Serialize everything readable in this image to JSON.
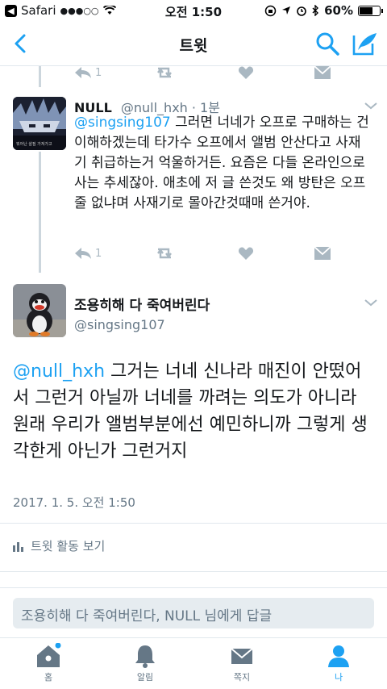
{
  "status_bar": {
    "back_app": "Safari",
    "signal": "●●●○○",
    "time": "오전 1:50",
    "battery": "60%"
  },
  "nav": {
    "title": "트윗"
  },
  "top_actions": {
    "reply_count": "1"
  },
  "reply_tweet": {
    "name": "NULL",
    "handle": "@null_hxh · 1분",
    "mention": "@singsing107",
    "text": " 그러면 너네가 오프로 구매하는 건 이해하겠는데 타가수 오프에서 앨범 안산다고 사재기 취급하는거 억울하거든. 요즘은 다들 온라인으로 사는 추세잖아. 애초에 저 글 쓴것도 왜 방탄은 오프줄 없냐며 사재기로 몰아간것때매 쓴거야.",
    "avatar_caption": "뭐어난 살짐 가져가고",
    "reply_count": "1"
  },
  "main_tweet": {
    "name": "조용히해 다 죽여버린다",
    "handle": "@singsing107",
    "mention": "@null_hxh",
    "text": " 그거는 너네 신나라 매진이 안떴어서 그런거 아닐까 너네를 까려는 의도가 아니라 원래 우리가 앨범부분에선 예민하니까 그렇게 생각한게 아닌가 그런거지",
    "date": "2017. 1. 5. 오전 1:50",
    "activity": "트윗 활동 보기"
  },
  "reply_box": {
    "placeholder": "조용히해 다 죽여버린다, NULL 님에게 답글"
  },
  "tabs": [
    {
      "label": "홈",
      "icon": "home-icon"
    },
    {
      "label": "알림",
      "icon": "bell-icon"
    },
    {
      "label": "쪽지",
      "icon": "envelope-icon"
    },
    {
      "label": "나",
      "icon": "person-icon"
    }
  ],
  "colors": {
    "accent": "#1da1f2",
    "muted": "#657786",
    "icon_gray": "#aab8c2"
  }
}
